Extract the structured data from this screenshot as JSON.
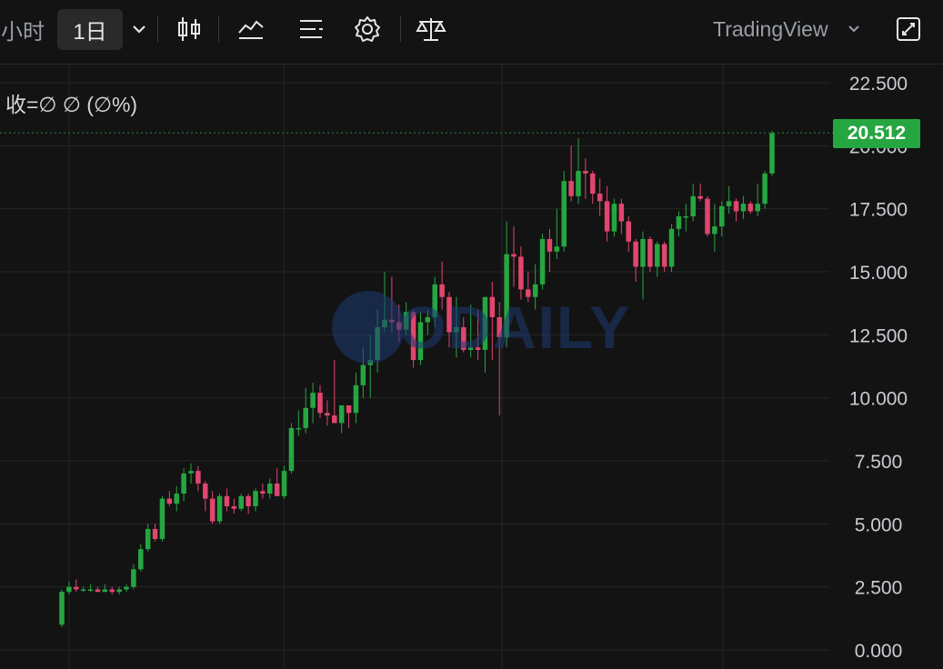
{
  "toolbar": {
    "interval_cut": "小时",
    "interval_selected": "1日",
    "provider": "TradingView",
    "icons": [
      "chevron-down-icon",
      "candles-icon",
      "indicators-icon",
      "list-icon",
      "gear-icon",
      "balance-icon",
      "chevron-down-icon",
      "fullscreen-icon"
    ]
  },
  "legend": {
    "text": "收=∅  ∅ (∅%)"
  },
  "price_tag": {
    "value": "20.512",
    "color": "#26a641"
  },
  "watermark": {
    "text": "ODAILY",
    "color": "#1d3a73"
  },
  "colors": {
    "up": "#26a641",
    "down": "#e0466e",
    "background": "#131313",
    "grid": "#262626"
  },
  "chart_data": {
    "type": "candlestick",
    "y_axis": {
      "min": 0,
      "max": 22.5,
      "ticks": [
        "22.500",
        "20.000",
        "17.500",
        "15.000",
        "12.500",
        "10.000",
        "7.500",
        "5.000",
        "2.500",
        "0.000"
      ],
      "tick_values": [
        22.5,
        20,
        17.5,
        15,
        12.5,
        10,
        7.5,
        5,
        2.5,
        0
      ]
    },
    "last_price": 20.512,
    "candles": [
      [
        1.0,
        2.4,
        0.9,
        2.3
      ],
      [
        2.3,
        2.7,
        2.2,
        2.5
      ],
      [
        2.5,
        2.8,
        2.3,
        2.4
      ],
      [
        2.4,
        2.5,
        2.3,
        2.4
      ],
      [
        2.4,
        2.6,
        2.3,
        2.4
      ],
      [
        2.4,
        2.5,
        2.3,
        2.3
      ],
      [
        2.3,
        2.6,
        2.3,
        2.4
      ],
      [
        2.4,
        2.5,
        2.2,
        2.3
      ],
      [
        2.3,
        2.5,
        2.2,
        2.4
      ],
      [
        2.4,
        2.6,
        2.3,
        2.5
      ],
      [
        2.5,
        3.4,
        2.4,
        3.2
      ],
      [
        3.2,
        4.2,
        3.1,
        4.0
      ],
      [
        4.0,
        5.0,
        3.9,
        4.8
      ],
      [
        4.8,
        5.0,
        4.3,
        4.4
      ],
      [
        4.4,
        6.1,
        4.3,
        6.0
      ],
      [
        6.0,
        6.3,
        5.7,
        5.8
      ],
      [
        5.8,
        6.5,
        5.5,
        6.2
      ],
      [
        6.2,
        7.2,
        5.9,
        7.0
      ],
      [
        7.0,
        7.4,
        6.6,
        7.1
      ],
      [
        7.1,
        7.3,
        6.3,
        6.6
      ],
      [
        6.6,
        6.7,
        5.5,
        6.0
      ],
      [
        6.0,
        6.3,
        5.0,
        5.1
      ],
      [
        5.1,
        6.2,
        5.0,
        6.1
      ],
      [
        6.1,
        6.4,
        5.5,
        5.7
      ],
      [
        5.7,
        6.0,
        5.4,
        5.6
      ],
      [
        5.6,
        6.2,
        5.5,
        6.1
      ],
      [
        6.1,
        6.2,
        5.4,
        5.7
      ],
      [
        5.7,
        6.4,
        5.5,
        6.3
      ],
      [
        6.3,
        6.6,
        6.0,
        6.2
      ],
      [
        6.2,
        6.8,
        6.0,
        6.6
      ],
      [
        6.6,
        7.2,
        6.3,
        6.1
      ],
      [
        6.1,
        7.3,
        6.0,
        7.1
      ],
      [
        7.1,
        9.0,
        7.0,
        8.8
      ],
      [
        8.8,
        9.5,
        8.5,
        8.8
      ],
      [
        8.8,
        10.4,
        8.6,
        9.6
      ],
      [
        9.6,
        10.6,
        9.0,
        10.2
      ],
      [
        10.2,
        10.5,
        9.2,
        9.4
      ],
      [
        9.4,
        9.9,
        8.9,
        9.3
      ],
      [
        9.3,
        11.5,
        9.0,
        9.0
      ],
      [
        9.0,
        9.6,
        8.6,
        9.7
      ],
      [
        9.7,
        9.7,
        8.8,
        9.4
      ],
      [
        9.4,
        11.0,
        9.0,
        10.5
      ],
      [
        10.5,
        12.0,
        10.0,
        11.3
      ],
      [
        11.3,
        12.5,
        10.0,
        11.5
      ],
      [
        11.5,
        13.5,
        11.0,
        12.8
      ],
      [
        12.8,
        15.0,
        12.6,
        13.1
      ],
      [
        13.1,
        14.8,
        12.6,
        13.0
      ],
      [
        13.0,
        13.7,
        12.2,
        12.7
      ],
      [
        12.7,
        13.8,
        12.5,
        13.4
      ],
      [
        13.4,
        13.5,
        11.2,
        11.5
      ],
      [
        11.5,
        13.4,
        11.3,
        13.0
      ],
      [
        13.0,
        13.5,
        12.5,
        13.2
      ],
      [
        13.2,
        14.8,
        12.8,
        14.5
      ],
      [
        14.5,
        15.4,
        13.5,
        14.0
      ],
      [
        14.0,
        14.2,
        12.0,
        12.6
      ],
      [
        12.6,
        14.0,
        11.6,
        12.8
      ],
      [
        12.8,
        13.2,
        11.8,
        11.9
      ],
      [
        11.9,
        13.7,
        11.6,
        12.0
      ],
      [
        12.0,
        13.5,
        11.5,
        11.9
      ],
      [
        11.9,
        14.0,
        11.0,
        14.0
      ],
      [
        14.0,
        14.6,
        11.5,
        13.2
      ],
      [
        13.2,
        13.8,
        9.3,
        12.4
      ],
      [
        12.4,
        17.0,
        12.0,
        15.7
      ],
      [
        15.7,
        16.8,
        14.4,
        15.6
      ],
      [
        15.6,
        16.0,
        13.9,
        14.3
      ],
      [
        14.3,
        15.0,
        13.8,
        14.0
      ],
      [
        14.0,
        15.3,
        13.5,
        14.5
      ],
      [
        14.5,
        16.5,
        14.3,
        16.3
      ],
      [
        16.3,
        16.7,
        15.0,
        15.8
      ],
      [
        15.8,
        17.5,
        15.5,
        16.0
      ],
      [
        16.0,
        19.0,
        15.8,
        18.6
      ],
      [
        18.6,
        20.0,
        17.8,
        18.0
      ],
      [
        18.0,
        20.3,
        17.7,
        19.0
      ],
      [
        19.0,
        19.5,
        17.9,
        18.9
      ],
      [
        18.9,
        19.0,
        17.7,
        18.1
      ],
      [
        18.1,
        18.7,
        17.2,
        17.8
      ],
      [
        17.8,
        18.4,
        16.2,
        16.6
      ],
      [
        16.6,
        17.9,
        16.4,
        17.7
      ],
      [
        17.7,
        17.9,
        16.5,
        17.0
      ],
      [
        17.0,
        17.2,
        15.8,
        16.2
      ],
      [
        16.2,
        16.3,
        14.6,
        15.2
      ],
      [
        15.2,
        16.6,
        13.9,
        16.3
      ],
      [
        16.3,
        16.4,
        15.0,
        15.2
      ],
      [
        15.2,
        16.2,
        14.8,
        16.1
      ],
      [
        16.1,
        16.2,
        15.0,
        15.2
      ],
      [
        15.2,
        16.9,
        15.0,
        16.7
      ],
      [
        16.7,
        17.4,
        16.4,
        17.2
      ],
      [
        17.2,
        17.7,
        16.6,
        17.2
      ],
      [
        17.2,
        18.5,
        17.0,
        18.0
      ],
      [
        18.0,
        18.5,
        17.8,
        17.9
      ],
      [
        17.9,
        18.0,
        16.4,
        16.5
      ],
      [
        16.5,
        17.7,
        15.8,
        16.8
      ],
      [
        16.8,
        17.8,
        16.4,
        17.6
      ],
      [
        17.6,
        18.4,
        17.3,
        17.8
      ],
      [
        17.8,
        17.9,
        17.0,
        17.4
      ],
      [
        17.4,
        18.0,
        17.1,
        17.7
      ],
      [
        17.7,
        17.8,
        17.3,
        17.4
      ],
      [
        17.4,
        18.5,
        17.2,
        17.7
      ],
      [
        17.7,
        19.0,
        17.5,
        18.9
      ],
      [
        18.9,
        20.6,
        18.8,
        20.5
      ]
    ]
  }
}
